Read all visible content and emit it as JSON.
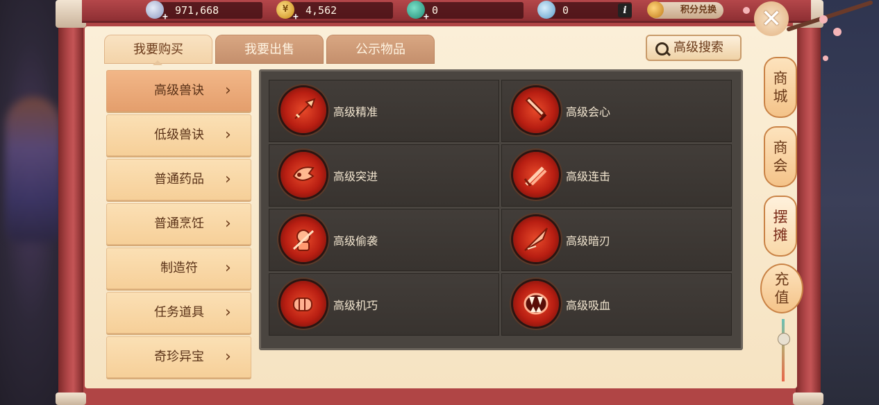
{
  "resources": [
    {
      "name": "silver",
      "value": "971,668",
      "color": "#9aa7c9"
    },
    {
      "name": "gold",
      "value": "4,562",
      "color": "#e9b23a"
    },
    {
      "name": "jade",
      "value": "0",
      "color": "#3ab8a0"
    },
    {
      "name": "fairy",
      "value": "0",
      "color": "#8fc6e8"
    }
  ],
  "info_label": "i",
  "exchange_label": "积分兑换",
  "tabs": [
    {
      "label": "我要购买",
      "active": true
    },
    {
      "label": "我要出售",
      "active": false
    },
    {
      "label": "公示物品",
      "active": false
    }
  ],
  "search_label": "高级搜索",
  "categories": [
    {
      "label": "高级兽诀",
      "active": true
    },
    {
      "label": "低级兽诀",
      "active": false
    },
    {
      "label": "普通药品",
      "active": false
    },
    {
      "label": "普通烹饪",
      "active": false
    },
    {
      "label": "制造符",
      "active": false
    },
    {
      "label": "任务道具",
      "active": false
    },
    {
      "label": "奇珍异宝",
      "active": false
    }
  ],
  "chevron": "›",
  "items": [
    {
      "label": "高级精准",
      "icon": "arrow-icon"
    },
    {
      "label": "高级会心",
      "icon": "sword-icon"
    },
    {
      "label": "高级突进",
      "icon": "charge-icon"
    },
    {
      "label": "高级连击",
      "icon": "combo-icon"
    },
    {
      "label": "高级偷袭",
      "icon": "ambush-icon"
    },
    {
      "label": "高级暗刃",
      "icon": "blade-icon"
    },
    {
      "label": "高级机巧",
      "icon": "fist-icon"
    },
    {
      "label": "高级吸血",
      "icon": "fang-icon"
    }
  ],
  "side_tabs": [
    {
      "label_top": "商",
      "label_bottom": "城"
    },
    {
      "label_top": "商",
      "label_bottom": "会"
    },
    {
      "label_top": "摆",
      "label_bottom": "摊"
    },
    {
      "label_top": "充",
      "label_bottom": "值"
    }
  ],
  "colors": {
    "frame": "#b04545",
    "panel": "#fbefd8",
    "grid": "#4a4540",
    "accent": "#e84a2a"
  }
}
